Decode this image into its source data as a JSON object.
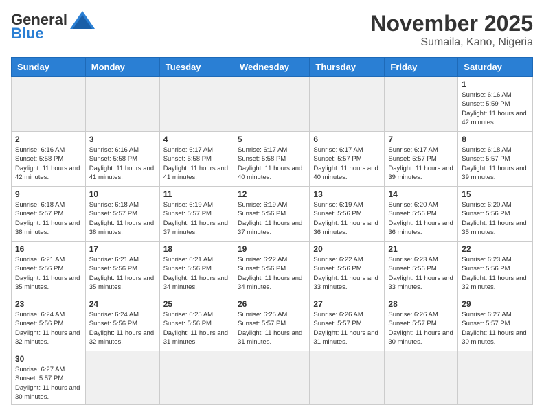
{
  "header": {
    "logo_general": "General",
    "logo_blue": "Blue",
    "month_title": "November 2025",
    "location": "Sumaila, Kano, Nigeria"
  },
  "weekdays": [
    "Sunday",
    "Monday",
    "Tuesday",
    "Wednesday",
    "Thursday",
    "Friday",
    "Saturday"
  ],
  "weeks": [
    [
      {
        "day": "",
        "info": ""
      },
      {
        "day": "",
        "info": ""
      },
      {
        "day": "",
        "info": ""
      },
      {
        "day": "",
        "info": ""
      },
      {
        "day": "",
        "info": ""
      },
      {
        "day": "",
        "info": ""
      },
      {
        "day": "1",
        "info": "Sunrise: 6:16 AM\nSunset: 5:59 PM\nDaylight: 11 hours and 42 minutes."
      }
    ],
    [
      {
        "day": "2",
        "info": "Sunrise: 6:16 AM\nSunset: 5:58 PM\nDaylight: 11 hours and 42 minutes."
      },
      {
        "day": "3",
        "info": "Sunrise: 6:16 AM\nSunset: 5:58 PM\nDaylight: 11 hours and 41 minutes."
      },
      {
        "day": "4",
        "info": "Sunrise: 6:17 AM\nSunset: 5:58 PM\nDaylight: 11 hours and 41 minutes."
      },
      {
        "day": "5",
        "info": "Sunrise: 6:17 AM\nSunset: 5:58 PM\nDaylight: 11 hours and 40 minutes."
      },
      {
        "day": "6",
        "info": "Sunrise: 6:17 AM\nSunset: 5:57 PM\nDaylight: 11 hours and 40 minutes."
      },
      {
        "day": "7",
        "info": "Sunrise: 6:17 AM\nSunset: 5:57 PM\nDaylight: 11 hours and 39 minutes."
      },
      {
        "day": "8",
        "info": "Sunrise: 6:18 AM\nSunset: 5:57 PM\nDaylight: 11 hours and 39 minutes."
      }
    ],
    [
      {
        "day": "9",
        "info": "Sunrise: 6:18 AM\nSunset: 5:57 PM\nDaylight: 11 hours and 38 minutes."
      },
      {
        "day": "10",
        "info": "Sunrise: 6:18 AM\nSunset: 5:57 PM\nDaylight: 11 hours and 38 minutes."
      },
      {
        "day": "11",
        "info": "Sunrise: 6:19 AM\nSunset: 5:57 PM\nDaylight: 11 hours and 37 minutes."
      },
      {
        "day": "12",
        "info": "Sunrise: 6:19 AM\nSunset: 5:56 PM\nDaylight: 11 hours and 37 minutes."
      },
      {
        "day": "13",
        "info": "Sunrise: 6:19 AM\nSunset: 5:56 PM\nDaylight: 11 hours and 36 minutes."
      },
      {
        "day": "14",
        "info": "Sunrise: 6:20 AM\nSunset: 5:56 PM\nDaylight: 11 hours and 36 minutes."
      },
      {
        "day": "15",
        "info": "Sunrise: 6:20 AM\nSunset: 5:56 PM\nDaylight: 11 hours and 35 minutes."
      }
    ],
    [
      {
        "day": "16",
        "info": "Sunrise: 6:21 AM\nSunset: 5:56 PM\nDaylight: 11 hours and 35 minutes."
      },
      {
        "day": "17",
        "info": "Sunrise: 6:21 AM\nSunset: 5:56 PM\nDaylight: 11 hours and 35 minutes."
      },
      {
        "day": "18",
        "info": "Sunrise: 6:21 AM\nSunset: 5:56 PM\nDaylight: 11 hours and 34 minutes."
      },
      {
        "day": "19",
        "info": "Sunrise: 6:22 AM\nSunset: 5:56 PM\nDaylight: 11 hours and 34 minutes."
      },
      {
        "day": "20",
        "info": "Sunrise: 6:22 AM\nSunset: 5:56 PM\nDaylight: 11 hours and 33 minutes."
      },
      {
        "day": "21",
        "info": "Sunrise: 6:23 AM\nSunset: 5:56 PM\nDaylight: 11 hours and 33 minutes."
      },
      {
        "day": "22",
        "info": "Sunrise: 6:23 AM\nSunset: 5:56 PM\nDaylight: 11 hours and 32 minutes."
      }
    ],
    [
      {
        "day": "23",
        "info": "Sunrise: 6:24 AM\nSunset: 5:56 PM\nDaylight: 11 hours and 32 minutes."
      },
      {
        "day": "24",
        "info": "Sunrise: 6:24 AM\nSunset: 5:56 PM\nDaylight: 11 hours and 32 minutes."
      },
      {
        "day": "25",
        "info": "Sunrise: 6:25 AM\nSunset: 5:56 PM\nDaylight: 11 hours and 31 minutes."
      },
      {
        "day": "26",
        "info": "Sunrise: 6:25 AM\nSunset: 5:57 PM\nDaylight: 11 hours and 31 minutes."
      },
      {
        "day": "27",
        "info": "Sunrise: 6:26 AM\nSunset: 5:57 PM\nDaylight: 11 hours and 31 minutes."
      },
      {
        "day": "28",
        "info": "Sunrise: 6:26 AM\nSunset: 5:57 PM\nDaylight: 11 hours and 30 minutes."
      },
      {
        "day": "29",
        "info": "Sunrise: 6:27 AM\nSunset: 5:57 PM\nDaylight: 11 hours and 30 minutes."
      }
    ],
    [
      {
        "day": "30",
        "info": "Sunrise: 6:27 AM\nSunset: 5:57 PM\nDaylight: 11 hours and 30 minutes."
      },
      {
        "day": "",
        "info": ""
      },
      {
        "day": "",
        "info": ""
      },
      {
        "day": "",
        "info": ""
      },
      {
        "day": "",
        "info": ""
      },
      {
        "day": "",
        "info": ""
      },
      {
        "day": "",
        "info": ""
      }
    ]
  ]
}
